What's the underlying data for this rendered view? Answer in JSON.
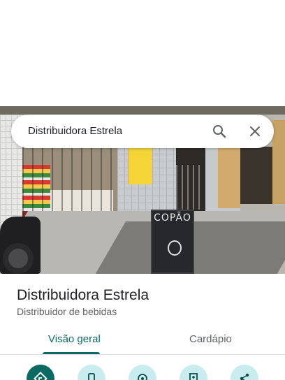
{
  "search": {
    "query": "Distribuidora Estrela"
  },
  "photo": {
    "board_text": "COPÃO"
  },
  "place": {
    "name": "Distribuidora Estrela",
    "category": "Distribuidor de bebidas"
  },
  "tabs": [
    {
      "label": "Visão geral",
      "active": true
    },
    {
      "label": "Cardápio",
      "active": false
    }
  ],
  "actions": [
    {
      "icon": "directions-icon"
    },
    {
      "icon": "phone-icon"
    },
    {
      "icon": "location-icon"
    },
    {
      "icon": "save-icon"
    },
    {
      "icon": "share-icon"
    }
  ],
  "colors": {
    "accent": "#0b6b63",
    "action_bg": "#c9ecee"
  }
}
